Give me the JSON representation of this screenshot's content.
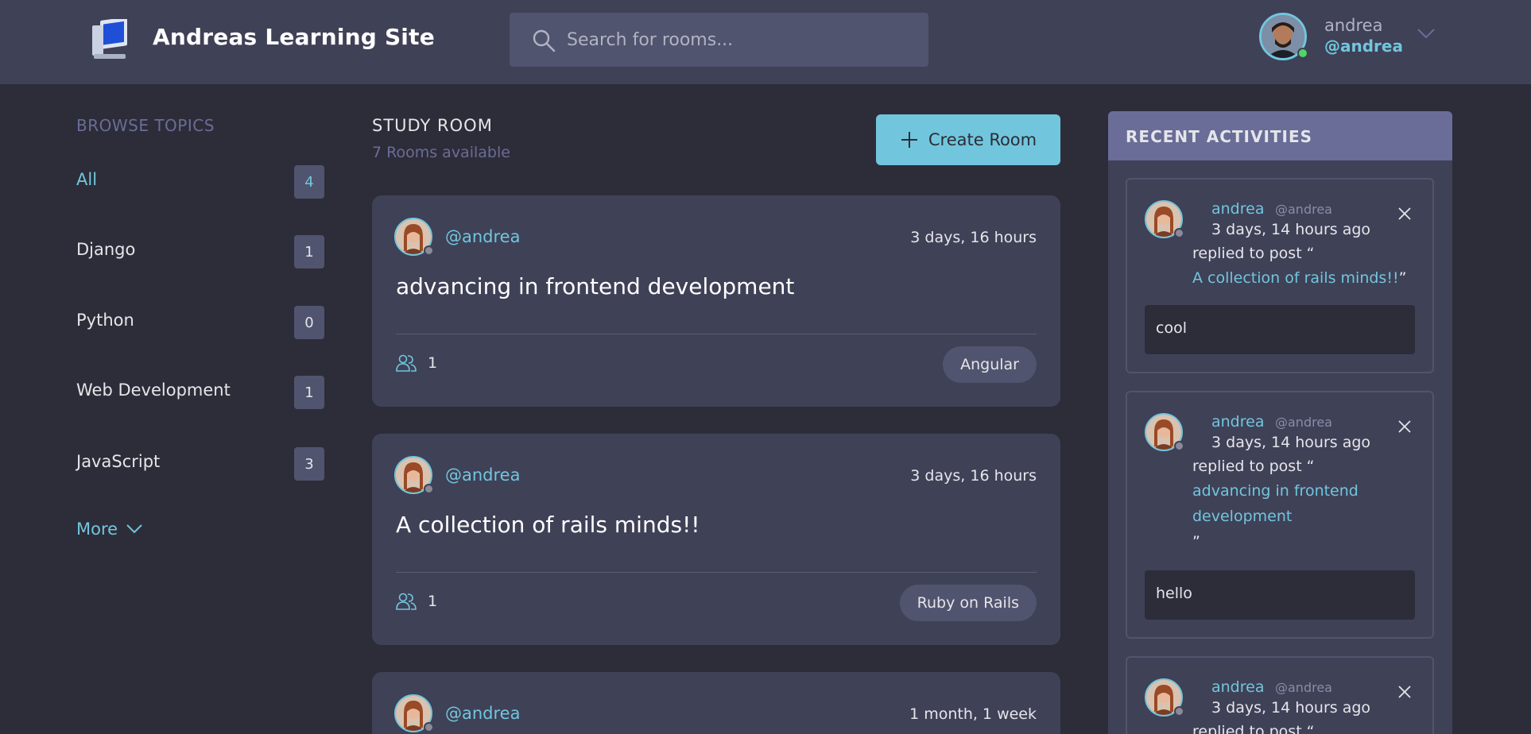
{
  "header": {
    "site_title": "Andreas Learning Site",
    "search_placeholder": "Search for rooms...",
    "user": {
      "name": "andrea",
      "handle": "@andrea"
    }
  },
  "sidebar": {
    "title": "BROWSE TOPICS",
    "topics": [
      {
        "label": "All",
        "count": "4"
      },
      {
        "label": "Django",
        "count": "1"
      },
      {
        "label": "Python",
        "count": "0"
      },
      {
        "label": "Web Development",
        "count": "1"
      },
      {
        "label": "JavaScript",
        "count": "3"
      }
    ],
    "more_label": "More"
  },
  "main": {
    "title": "STUDY ROOM",
    "subtitle": "7 Rooms available",
    "create_label": "Create Room",
    "rooms": [
      {
        "host": "@andrea",
        "time": "3 days, 16 hours",
        "title": "advancing in frontend development",
        "participants": "1",
        "topic": "Angular"
      },
      {
        "host": "@andrea",
        "time": "3 days, 16 hours",
        "title": "A collection of rails minds!!",
        "participants": "1",
        "topic": "Ruby on Rails"
      },
      {
        "host": "@andrea",
        "time": "1 month, 1 week"
      }
    ]
  },
  "activities": {
    "title": "RECENT ACTIVITIES",
    "items": [
      {
        "name": "andrea",
        "handle": "@andrea",
        "time": "3 days, 14 hours ago",
        "action": "replied to post “",
        "post": "A collection of rails minds!!",
        "quote_close": "”",
        "message": "cool"
      },
      {
        "name": "andrea",
        "handle": "@andrea",
        "time": "3 days, 14 hours ago",
        "action": "replied to post “",
        "post": "advancing in frontend development",
        "quote_close": "”",
        "message": "hello"
      },
      {
        "name": "andrea",
        "handle": "@andrea",
        "time": "3 days, 14 hours ago",
        "action": "replied to post “"
      }
    ]
  },
  "colors": {
    "background": "#2d2d39",
    "panel": "#3f4157",
    "accent": "#71c6dd",
    "muted": "#696d97"
  }
}
